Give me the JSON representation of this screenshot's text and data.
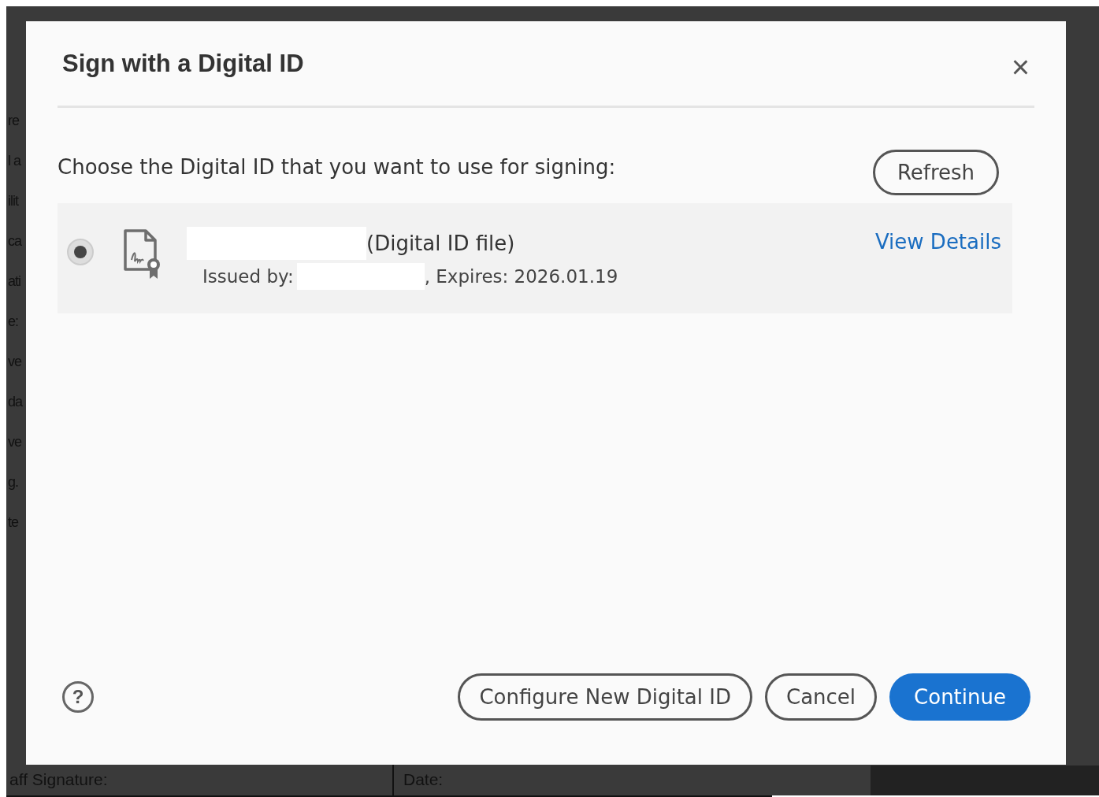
{
  "background": {
    "side_fragments": [
      "re",
      "l a",
      "ilit",
      "ca",
      "ati",
      "e:",
      "ve",
      "da",
      "ve",
      "g.",
      "te"
    ],
    "footer_cells": [
      "aff Signature:",
      "Date:"
    ]
  },
  "dialog": {
    "title": "Sign with a Digital ID",
    "close": "×",
    "prompt": "Choose the Digital ID that you want to use for signing:",
    "refresh": "Refresh",
    "ids": [
      {
        "selected": true,
        "name_suffix": "(Digital ID file)",
        "issued_label": "Issued by:",
        "expires": ", Expires: 2026.01.19",
        "details": "View Details"
      }
    ],
    "help": "?",
    "buttons": [
      {
        "kind": "secondary",
        "label": "Configure New Digital ID"
      },
      {
        "kind": "secondary",
        "label": "Cancel"
      },
      {
        "kind": "primary",
        "label": "Continue"
      }
    ]
  }
}
